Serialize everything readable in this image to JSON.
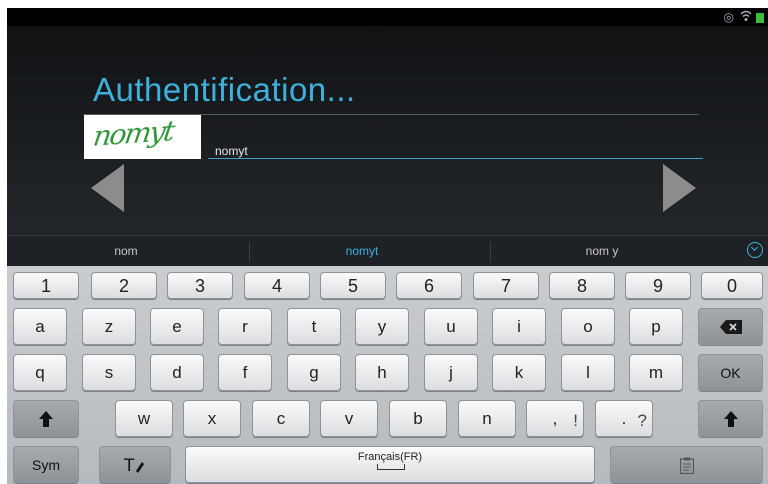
{
  "app": {
    "title": "Authentification...",
    "captcha_text": "nomyt",
    "input_value": "nomyt"
  },
  "suggestions": [
    "nom",
    "nomyt",
    "nom y"
  ],
  "keyboard": {
    "row_numbers": [
      "1",
      "2",
      "3",
      "4",
      "5",
      "6",
      "7",
      "8",
      "9",
      "0"
    ],
    "row_a": [
      "a",
      "z",
      "e",
      "r",
      "t",
      "y",
      "u",
      "i",
      "o",
      "p"
    ],
    "row_q": [
      "q",
      "s",
      "d",
      "f",
      "g",
      "h",
      "j",
      "k",
      "l",
      "m"
    ],
    "row_w": [
      "w",
      "x",
      "c",
      "v",
      "b",
      "n"
    ],
    "comma_main": ",",
    "comma_sup": "!",
    "period_main": ".",
    "period_sup": "?",
    "ok_label": "OK",
    "sym_label": "Sym",
    "space_label": "Français(FR)",
    "icons": {
      "backspace": "backspace-icon",
      "shift": "shift-icon",
      "text_tools": "handwriting-icon",
      "clipboard": "clipboard-icon",
      "expand": "chevron-down-circle-icon"
    }
  },
  "colors": {
    "accent": "#3db0dc",
    "captcha": "#2f9a3b",
    "battery": "#3bbf3b"
  }
}
